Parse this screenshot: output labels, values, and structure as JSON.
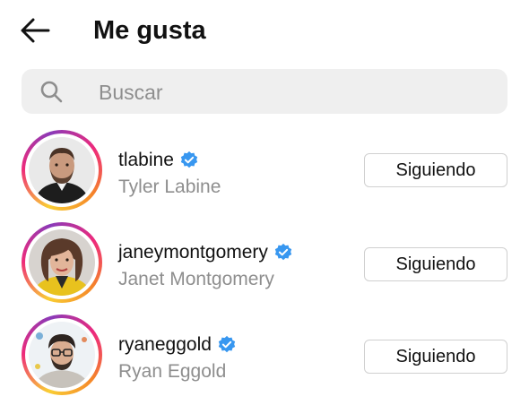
{
  "header": {
    "title": "Me gusta",
    "back_icon": "arrow-left-icon"
  },
  "search": {
    "placeholder": "Buscar",
    "icon": "search-icon"
  },
  "users": [
    {
      "username": "tlabine",
      "full_name": "Tyler Labine",
      "verified": true,
      "button_label": "Siguiendo"
    },
    {
      "username": "janeymontgomery",
      "full_name": "Janet Montgomery",
      "verified": true,
      "button_label": "Siguiendo"
    },
    {
      "username": "ryaneggold",
      "full_name": "Ryan Eggold",
      "verified": true,
      "button_label": "Siguiendo"
    }
  ],
  "colors": {
    "verified_badge": "#3897f0",
    "secondary_text": "#8e8e8e",
    "search_bg": "#efefef"
  }
}
